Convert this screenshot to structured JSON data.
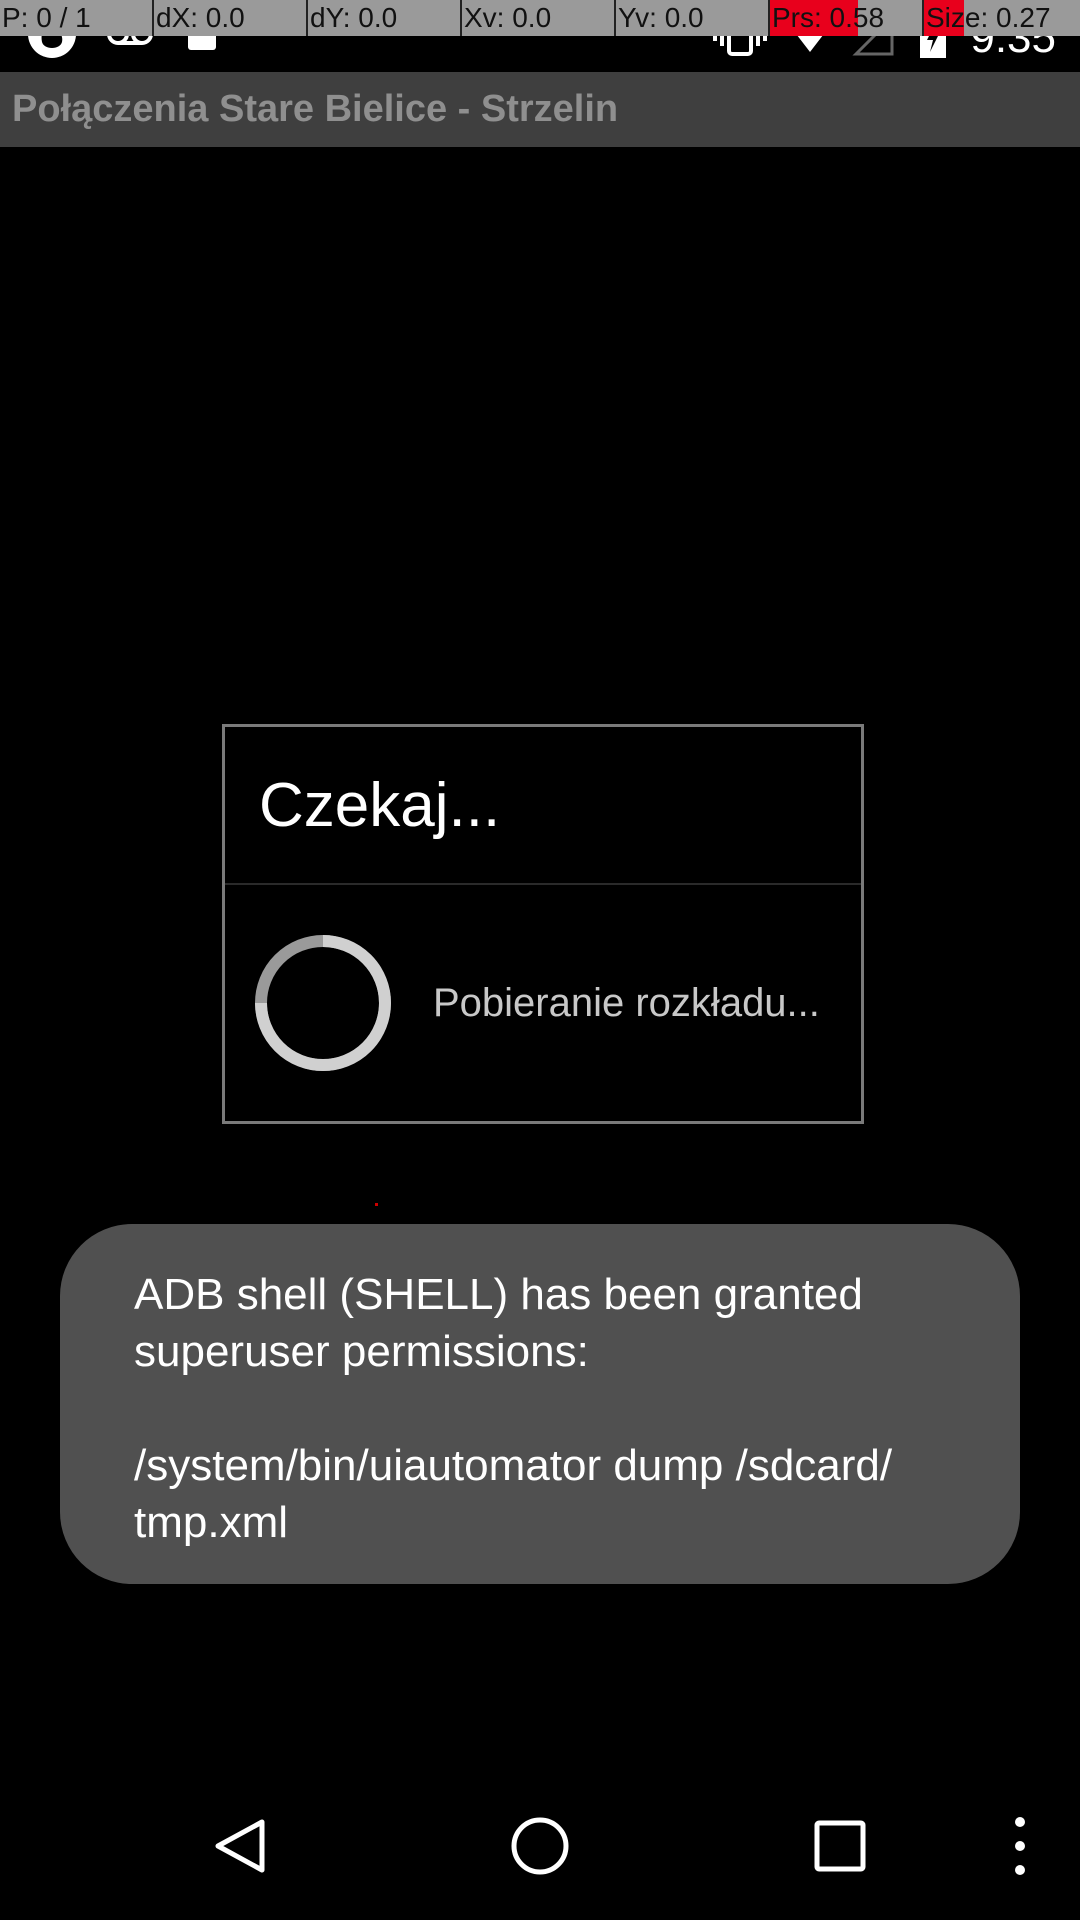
{
  "pointer_location": {
    "p": "P: 0 / 1",
    "dx": "dX: 0.0",
    "dy": "dY: 0.0",
    "xv": "Xv: 0.0",
    "yv": "Yv: 0.0",
    "prs": "Prs: 0.58",
    "size": "Size: 0.27"
  },
  "status_bar": {
    "time": "9:35",
    "left_icons": [
      "app-flame-icon",
      "voicemail-icon",
      "android-icon"
    ],
    "right_icons": [
      "vibrate-icon",
      "wifi-icon",
      "signal-icon",
      "battery-charging-icon"
    ]
  },
  "action_bar": {
    "title": "Połączenia Stare Bielice - Strzelin"
  },
  "dialog": {
    "title": "Czekaj...",
    "message": "Pobieranie rozkładu..."
  },
  "toast": {
    "line1": "ADB shell (SHELL) has been granted",
    "line2": "superuser permissions:",
    "line3": "/system/bin/uiautomator dump /sdcard/",
    "line4": "tmp.xml"
  },
  "nav_bar": {
    "buttons": [
      "back-icon",
      "home-icon",
      "recents-icon",
      "overflow-menu-icon"
    ]
  },
  "colors": {
    "action_bar": "#3f3f3f",
    "toast": "#505050",
    "pointer_strip": "#9a9a9a",
    "pointer_highlight": "#e8001c"
  }
}
